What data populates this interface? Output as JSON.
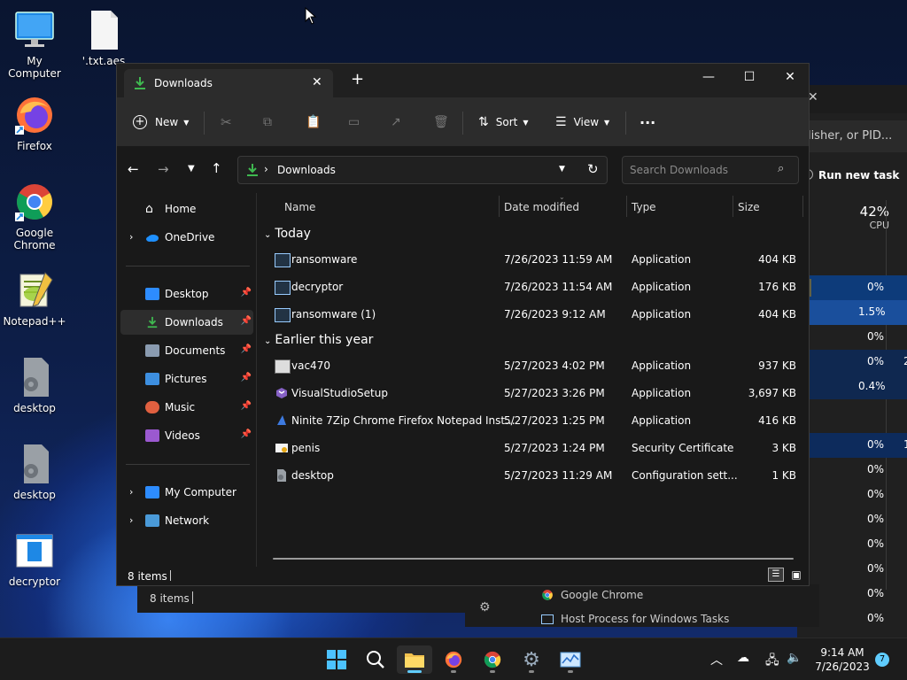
{
  "desktop": {
    "icons": [
      {
        "label": "My Computer"
      },
      {
        "label": "'.txt.aes"
      },
      {
        "label": "Firefox"
      },
      {
        "label": "Google Chrome"
      },
      {
        "label": "Notepad++"
      },
      {
        "label": "desktop"
      },
      {
        "label": "desktop"
      },
      {
        "label": "decryptor"
      }
    ]
  },
  "task_manager": {
    "search_placeholder": "olisher, or PID...",
    "run_new_task": "Run new task",
    "cpu_percent": "42%",
    "cpu_label": "CPU",
    "rows": [
      "0%",
      "1.5%",
      "0%",
      "0%",
      "0.4%",
      "0%",
      "0%",
      "0%",
      "0%",
      "0%",
      "0%",
      "0%",
      "0%"
    ],
    "side_values": [
      "2",
      "1"
    ],
    "processes": [
      "Google Chrome",
      "Host Process for Windows Tasks"
    ],
    "status": "8 items"
  },
  "explorer": {
    "tab_title": "Downloads",
    "toolbar": {
      "new_label": "New",
      "sort_label": "Sort",
      "view_label": "View",
      "more_label": "···"
    },
    "address": {
      "location": "Downloads"
    },
    "search": {
      "placeholder": "Search Downloads"
    },
    "nav": {
      "home": "Home",
      "onedrive": "OneDrive",
      "desktop": "Desktop",
      "downloads": "Downloads",
      "documents": "Documents",
      "pictures": "Pictures",
      "music": "Music",
      "videos": "Videos",
      "my_computer": "My Computer",
      "network": "Network"
    },
    "columns": {
      "name": "Name",
      "date": "Date modified",
      "type": "Type",
      "size": "Size"
    },
    "groups": {
      "today": "Today",
      "earlier": "Earlier this year"
    },
    "files_today": [
      {
        "name": "ransomware",
        "date": "7/26/2023 11:59 AM",
        "type": "Application",
        "size": "404 KB"
      },
      {
        "name": "decryptor",
        "date": "7/26/2023 11:54 AM",
        "type": "Application",
        "size": "176 KB"
      },
      {
        "name": "ransomware (1)",
        "date": "7/26/2023 9:12 AM",
        "type": "Application",
        "size": "404 KB"
      }
    ],
    "files_earlier": [
      {
        "name": "vac470",
        "date": "5/27/2023 4:02 PM",
        "type": "Application",
        "size": "937 KB"
      },
      {
        "name": "VisualStudioSetup",
        "date": "5/27/2023 3:26 PM",
        "type": "Application",
        "size": "3,697 KB"
      },
      {
        "name": "Ninite 7Zip Chrome Firefox Notepad Inst...",
        "date": "5/27/2023 1:25 PM",
        "type": "Application",
        "size": "416 KB"
      },
      {
        "name": "penis",
        "date": "5/27/2023 1:24 PM",
        "type": "Security Certificate",
        "size": "3 KB"
      },
      {
        "name": "desktop",
        "date": "5/27/2023 11:29 AM",
        "type": "Configuration sett...",
        "size": "1 KB"
      }
    ],
    "status": "8 items"
  },
  "taskbar": {
    "time": "9:14 AM",
    "date": "7/26/2023",
    "notification_count": "7"
  },
  "colors": {
    "accent": "#60cdff",
    "downloads_green": "#3fb950",
    "explorer_bg": "#191919",
    "toolbar_bg": "#2c2c2c"
  }
}
